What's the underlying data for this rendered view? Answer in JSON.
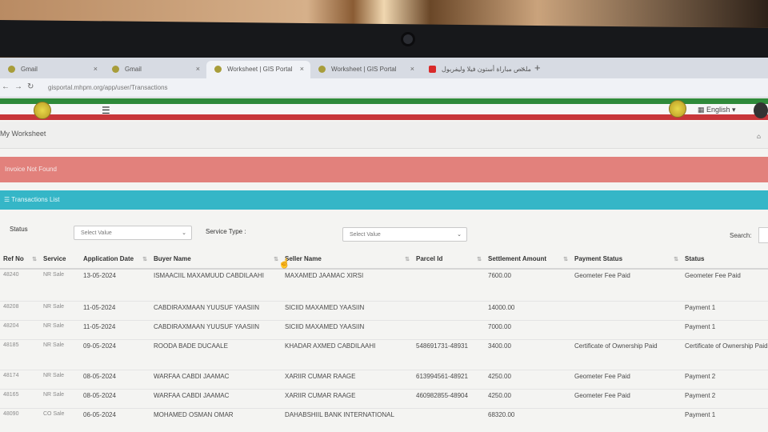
{
  "browser": {
    "tabs": [
      {
        "label": "Gmail",
        "active": false
      },
      {
        "label": "Gmail",
        "active": false
      },
      {
        "label": "Worksheet | GIS Portal",
        "active": true
      },
      {
        "label": "Worksheet | GIS Portal",
        "active": false
      },
      {
        "label": "ملخص مباراة أستون فيلا وليفربول",
        "active": false
      }
    ],
    "url": "gisportal.mhpm.org/app/user/Transactions"
  },
  "header": {
    "language": "English"
  },
  "page": {
    "title": "My Worksheet"
  },
  "alert": {
    "text": "Invoice Not Found"
  },
  "panel": {
    "title": "Transactions List"
  },
  "filters": {
    "status_label": "Status",
    "status_placeholder": "Select Value",
    "service_type_label": "Service Type :",
    "service_type_placeholder": "Select Value",
    "search_label": "Search:"
  },
  "table": {
    "columns": [
      "Ref No",
      "Service",
      "Application Date",
      "Buyer Name",
      "Seller Name",
      "Parcel Id",
      "Settlement Amount",
      "Payment Status",
      "Status"
    ],
    "rows": [
      {
        "ref": "48240",
        "service": "NR Sale",
        "date": "13-05-2024",
        "buyer": "ISMAACIIL MAXAMUUD CABDILAAHI",
        "seller": "MAXAMED JAAMAC XIRSI",
        "parcel": "",
        "amount": "7600.00",
        "payment": "Geometer Fee Paid",
        "status": "Geometer Fee Paid"
      },
      {
        "ref": "48208",
        "service": "NR Sale",
        "date": "11-05-2024",
        "buyer": "CABDIRAXMAAN YUUSUF YAASIIN",
        "seller": "SICIID MAXAMED YAASIIN",
        "parcel": "",
        "amount": "14000.00",
        "payment": "",
        "status": "Payment 1"
      },
      {
        "ref": "48204",
        "service": "NR Sale",
        "date": "11-05-2024",
        "buyer": "CABDIRAXMAAN YUUSUF YAASIIN",
        "seller": "SICIID MAXAMED YAASIIN",
        "parcel": "",
        "amount": "7000.00",
        "payment": "",
        "status": "Payment 1"
      },
      {
        "ref": "48185",
        "service": "NR Sale",
        "date": "09-05-2024",
        "buyer": "ROODA BADE DUCAALE",
        "seller": "KHADAR AXMED CABDILAAHI",
        "parcel": "548691731-48931",
        "amount": "3400.00",
        "payment": "Certificate of Ownership Paid",
        "status": "Certificate of Ownership Paid"
      },
      {
        "ref": "48174",
        "service": "NR Sale",
        "date": "08-05-2024",
        "buyer": "WARFAA CABDI JAAMAC",
        "seller": "XARIIR CUMAR RAAGE",
        "parcel": "613994561-48921",
        "amount": "4250.00",
        "payment": "Geometer Fee Paid",
        "status": "Payment 2"
      },
      {
        "ref": "48165",
        "service": "NR Sale",
        "date": "08-05-2024",
        "buyer": "WARFAA CABDI JAAMAC",
        "seller": "XARIIR CUMAR RAAGE",
        "parcel": "460982855-48904",
        "amount": "4250.00",
        "payment": "Geometer Fee Paid",
        "status": "Payment 2"
      },
      {
        "ref": "48090",
        "service": "CO Sale",
        "date": "06-05-2024",
        "buyer": "MOHAMED OSMAN OMAR",
        "seller": "DAHABSHIIL BANK INTERNATIONAL",
        "parcel": "",
        "amount": "68320.00",
        "payment": "",
        "status": "Payment 1"
      }
    ]
  }
}
